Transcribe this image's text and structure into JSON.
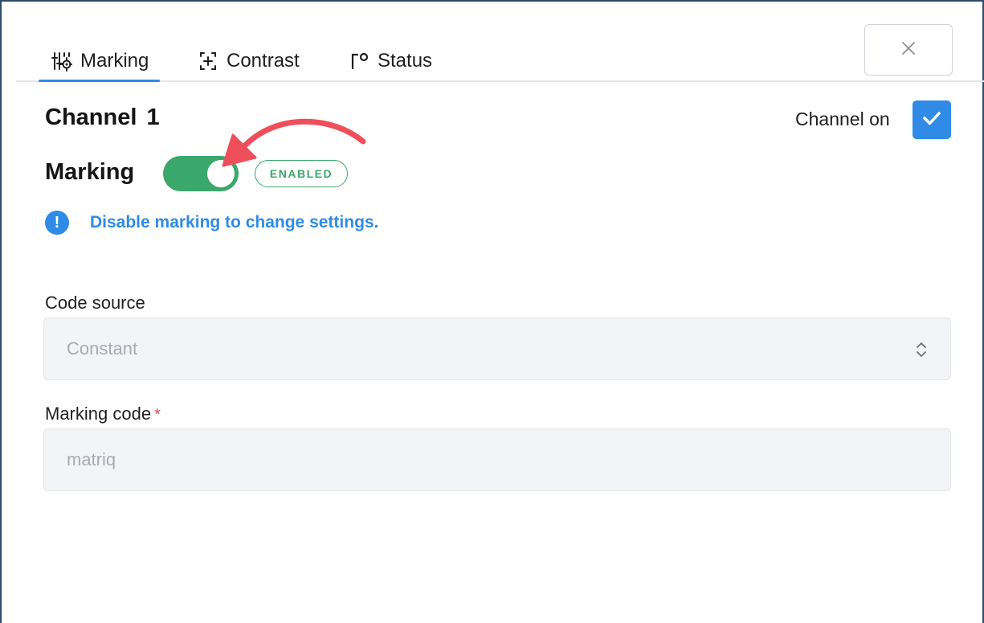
{
  "tabs": [
    {
      "label": "Marking",
      "icon": "sliders-gear-icon",
      "active": true
    },
    {
      "label": "Contrast",
      "icon": "contrast-plus-icon",
      "active": false
    },
    {
      "label": "Status",
      "icon": "status-bracket-icon",
      "active": false
    }
  ],
  "close": {
    "icon": "close-icon"
  },
  "channel": {
    "title": "Channel  1",
    "on_label": "Channel on",
    "on": true
  },
  "marking": {
    "label": "Marking",
    "enabled": true,
    "badge": "ENABLED"
  },
  "info": {
    "icon": "exclamation-icon",
    "text": "Disable marking to change settings."
  },
  "fields": {
    "code_source": {
      "label": "Code source",
      "value": "Constant"
    },
    "marking_code": {
      "label": "Marking code",
      "required_mark": "*",
      "value": "matriq"
    }
  },
  "colors": {
    "accent": "#2f8be6",
    "success": "#3aa86a",
    "annotation_arrow": "#ef4f5a"
  }
}
